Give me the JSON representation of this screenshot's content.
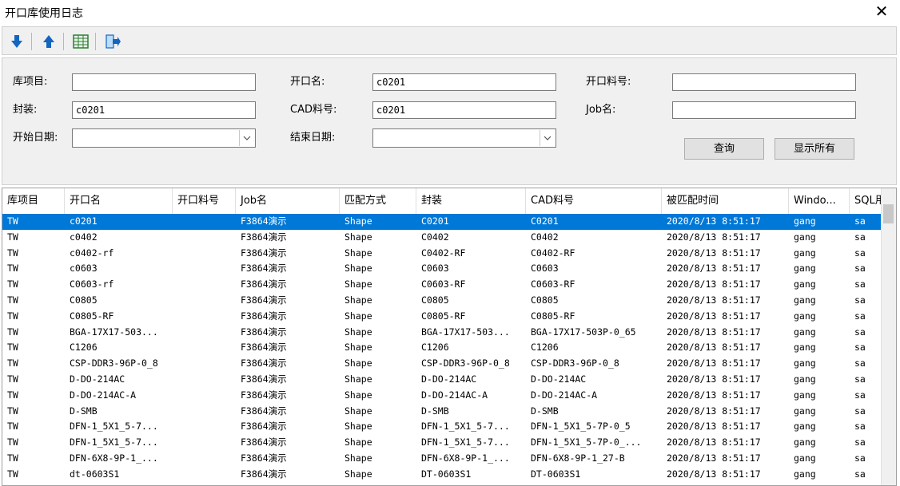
{
  "window": {
    "title": "开口库使用日志"
  },
  "toolbar": {
    "buttons": [
      {
        "icon": "arrow-down-icon",
        "color": "#1565c0"
      },
      {
        "icon": "arrow-up-icon",
        "color": "#1565c0"
      },
      {
        "icon": "spreadsheet-icon",
        "color": "#2e7d32"
      },
      {
        "icon": "exit-door-icon",
        "color": "#1565c0"
      }
    ]
  },
  "filters": {
    "lib_item": {
      "label": "库项目:",
      "value": ""
    },
    "opening_name": {
      "label": "开口名:",
      "value": "c0201"
    },
    "opening_material": {
      "label": "开口料号:",
      "value": ""
    },
    "package": {
      "label": "封装:",
      "value": "c0201"
    },
    "cad_material": {
      "label": "CAD料号:",
      "value": "c0201"
    },
    "job_name": {
      "label": "Job名:",
      "value": ""
    },
    "start_date": {
      "label": "开始日期:",
      "value": ""
    },
    "end_date": {
      "label": "结束日期:",
      "value": ""
    },
    "query_button": "查询",
    "show_all_button": "显示所有"
  },
  "grid": {
    "columns": [
      "库项目",
      "开口名",
      "开口料号",
      "Job名",
      "匹配方式",
      "封装",
      "CAD料号",
      "被匹配时间",
      "Windo...",
      "SQL用"
    ],
    "selected_row": 0,
    "selection_color": "#0078d7",
    "rows": [
      [
        "TW",
        "c0201",
        "",
        "F3864演示",
        "Shape",
        "C0201",
        "C0201",
        "2020/8/13 8:51:17",
        "gang",
        "sa"
      ],
      [
        "TW",
        "c0402",
        "",
        "F3864演示",
        "Shape",
        "C0402",
        "C0402",
        "2020/8/13 8:51:17",
        "gang",
        "sa"
      ],
      [
        "TW",
        "c0402-rf",
        "",
        "F3864演示",
        "Shape",
        "C0402-RF",
        "C0402-RF",
        "2020/8/13 8:51:17",
        "gang",
        "sa"
      ],
      [
        "TW",
        "c0603",
        "",
        "F3864演示",
        "Shape",
        "C0603",
        "C0603",
        "2020/8/13 8:51:17",
        "gang",
        "sa"
      ],
      [
        "TW",
        "C0603-rf",
        "",
        "F3864演示",
        "Shape",
        "C0603-RF",
        "C0603-RF",
        "2020/8/13 8:51:17",
        "gang",
        "sa"
      ],
      [
        "TW",
        "C0805",
        "",
        "F3864演示",
        "Shape",
        "C0805",
        "C0805",
        "2020/8/13 8:51:17",
        "gang",
        "sa"
      ],
      [
        "TW",
        "C0805-RF",
        "",
        "F3864演示",
        "Shape",
        "C0805-RF",
        "C0805-RF",
        "2020/8/13 8:51:17",
        "gang",
        "sa"
      ],
      [
        "TW",
        "BGA-17X17-503...",
        "",
        "F3864演示",
        "Shape",
        "BGA-17X17-503...",
        "BGA-17X17-503P-0_65",
        "2020/8/13 8:51:17",
        "gang",
        "sa"
      ],
      [
        "TW",
        "C1206",
        "",
        "F3864演示",
        "Shape",
        "C1206",
        "C1206",
        "2020/8/13 8:51:17",
        "gang",
        "sa"
      ],
      [
        "TW",
        "CSP-DDR3-96P-0_8",
        "",
        "F3864演示",
        "Shape",
        "CSP-DDR3-96P-0_8",
        "CSP-DDR3-96P-0_8",
        "2020/8/13 8:51:17",
        "gang",
        "sa"
      ],
      [
        "TW",
        "D-DO-214AC",
        "",
        "F3864演示",
        "Shape",
        "D-DO-214AC",
        "D-DO-214AC",
        "2020/8/13 8:51:17",
        "gang",
        "sa"
      ],
      [
        "TW",
        "D-DO-214AC-A",
        "",
        "F3864演示",
        "Shape",
        "D-DO-214AC-A",
        "D-DO-214AC-A",
        "2020/8/13 8:51:17",
        "gang",
        "sa"
      ],
      [
        "TW",
        "D-SMB",
        "",
        "F3864演示",
        "Shape",
        "D-SMB",
        "D-SMB",
        "2020/8/13 8:51:17",
        "gang",
        "sa"
      ],
      [
        "TW",
        "DFN-1_5X1_5-7...",
        "",
        "F3864演示",
        "Shape",
        "DFN-1_5X1_5-7...",
        "DFN-1_5X1_5-7P-0_5",
        "2020/8/13 8:51:17",
        "gang",
        "sa"
      ],
      [
        "TW",
        "DFN-1_5X1_5-7...",
        "",
        "F3864演示",
        "Shape",
        "DFN-1_5X1_5-7...",
        "DFN-1_5X1_5-7P-0_...",
        "2020/8/13 8:51:17",
        "gang",
        "sa"
      ],
      [
        "TW",
        "DFN-6X8-9P-1_...",
        "",
        "F3864演示",
        "Shape",
        "DFN-6X8-9P-1_...",
        "DFN-6X8-9P-1_27-B",
        "2020/8/13 8:51:17",
        "gang",
        "sa"
      ],
      [
        "TW",
        "dt-0603S1",
        "",
        "F3864演示",
        "Shape",
        "DT-0603S1",
        "DT-0603S1",
        "2020/8/13 8:51:17",
        "gang",
        "sa"
      ]
    ]
  }
}
